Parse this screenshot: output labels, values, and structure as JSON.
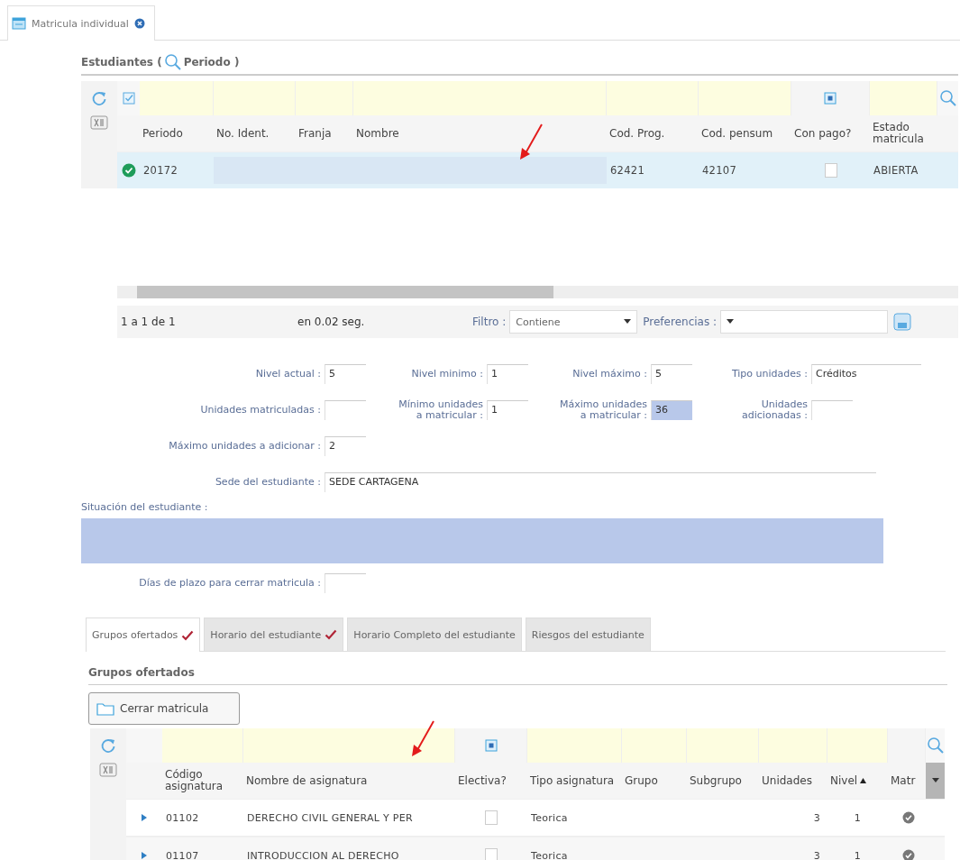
{
  "page_tab": {
    "label": "Matricula individual",
    "selected": true
  },
  "students": {
    "title_before": "Estudiantes (",
    "title_after": "Periodo )",
    "annotation_arrow": true,
    "columns": [
      {
        "label": "Periodo",
        "kind": "text"
      },
      {
        "label": "No. Ident.",
        "kind": "text"
      },
      {
        "label": "Franja",
        "kind": "text"
      },
      {
        "label": "Nombre",
        "kind": "text"
      },
      {
        "label": "Cod. Prog.",
        "kind": "text"
      },
      {
        "label": "Cod. pensum",
        "kind": "text"
      },
      {
        "label": "Con pago?",
        "kind": "check"
      },
      {
        "label": "Estado matricula",
        "kind": "text"
      }
    ],
    "rows": [
      {
        "selected": true,
        "valid": true,
        "cells": [
          {
            "text": "20172"
          },
          {
            "redacted": true
          },
          {
            "redacted": true
          },
          {
            "redacted": true
          },
          {
            "text": "62421"
          },
          {
            "text": "42107"
          },
          {
            "checked": false
          },
          {
            "text": "ABIERTA"
          }
        ]
      }
    ],
    "pager": {
      "range": "1 a 1 de 1",
      "time": "en 0.02 seg.",
      "filter_label": "Filtro :",
      "filter_value": "Contiene",
      "prefs_label": "Preferencias :"
    }
  },
  "form": {
    "rows": [
      [
        {
          "kind": "short",
          "label": "Nivel actual :",
          "value": "5",
          "highlighted": false
        },
        {
          "kind": "short",
          "label": "Nivel minimo :",
          "value": "1",
          "highlighted": false
        },
        {
          "kind": "short",
          "label": "Nivel máximo :",
          "value": "5",
          "highlighted": false
        },
        {
          "kind": "long",
          "label": "Tipo unidades :",
          "value": "Créditos",
          "highlighted": false
        }
      ],
      [
        {
          "kind": "short",
          "label": "Unidades matriculadas :",
          "highlighted": false
        },
        {
          "kind": "short",
          "label": "Mínimo unidades a matricular :",
          "value": "1",
          "highlighted": false
        },
        {
          "kind": "short",
          "label": "Máximo unidades a matricular :",
          "value": "36",
          "highlighted": true
        },
        {
          "kind": "short",
          "label": "Unidades adicionadas :",
          "highlighted": false
        }
      ],
      [
        {
          "kind": "short",
          "label": "Máximo unidades a adicionar :",
          "value": "2",
          "highlighted": false
        }
      ],
      [
        {
          "kind": "wide",
          "label": "Sede del estudiante :",
          "value": "SEDE CARTAGENA",
          "highlighted": false
        }
      ],
      [
        {
          "kind": "area",
          "label": "Situación del estudiante :",
          "highlighted": true
        }
      ],
      [
        {
          "kind": "short",
          "label": "Días de plazo para cerrar matricula :",
          "highlighted": false
        }
      ]
    ]
  },
  "tabs": [
    {
      "label": "Grupos ofertados",
      "selected": true,
      "checkmark": true
    },
    {
      "label": "Horario del estudiante",
      "selected": false,
      "checkmark": true
    },
    {
      "label": "Horario Completo del estudiante",
      "selected": false,
      "checkmark": false
    },
    {
      "label": "Riesgos del estudiante",
      "selected": false,
      "checkmark": false
    }
  ],
  "groups": {
    "title": "Grupos ofertados",
    "button": "Cerrar matricula",
    "annotation_arrow": true,
    "columns": [
      {
        "label": "Código asignatura",
        "kind": "text"
      },
      {
        "label": "Nombre de asignatura",
        "kind": "text"
      },
      {
        "label": "Electiva?",
        "kind": "check"
      },
      {
        "label": "Tipo asignatura",
        "kind": "text"
      },
      {
        "label": "Grupo",
        "kind": "text"
      },
      {
        "label": "Subgrupo",
        "kind": "text"
      },
      {
        "label": "Unidades",
        "kind": "text"
      },
      {
        "label": "Nivel",
        "kind": "text",
        "sorted": true
      },
      {
        "label": "Matr",
        "kind": "none"
      }
    ],
    "rows": [
      {
        "expanded": false,
        "cells": [
          {
            "text": "01102"
          },
          {
            "text": "DERECHO CIVIL GENERAL Y PER"
          },
          {
            "checked": false
          },
          {
            "text": "Teorica"
          },
          {},
          {},
          {
            "text": "3"
          },
          {
            "text": "1"
          },
          {
            "done": true
          }
        ]
      },
      {
        "expanded": false,
        "cells": [
          {
            "text": "01107"
          },
          {
            "text": "INTRODUCCION AL DERECHO"
          },
          {
            "checked": false
          },
          {
            "text": "Teorica"
          },
          {},
          {},
          {
            "text": "3"
          },
          {
            "text": "1"
          },
          {
            "done": true
          }
        ]
      }
    ]
  }
}
